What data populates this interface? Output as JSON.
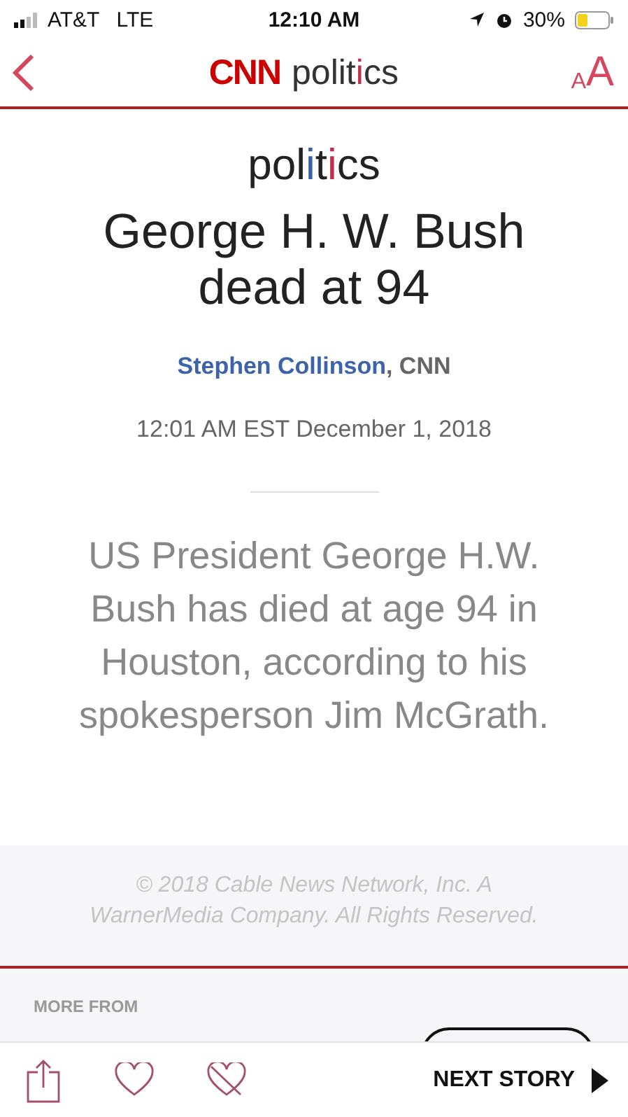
{
  "status_bar": {
    "carrier": "AT&T",
    "network": "LTE",
    "time": "12:10 AM",
    "battery": "30%"
  },
  "nav_bar": {
    "logo": "CNN",
    "section": [
      {
        "text": "polit",
        "color": "#333333"
      },
      {
        "text": "i",
        "color": "#c0304a"
      },
      {
        "text": "cs",
        "color": "#333333"
      }
    ],
    "text_size_small": "A",
    "text_size_large": "A"
  },
  "article": {
    "section_label": [
      {
        "text": "pol",
        "color": "#222222"
      },
      {
        "text": "i",
        "color": "#3b5ea8"
      },
      {
        "text": "t",
        "color": "#222222"
      },
      {
        "text": "i",
        "color": "#c0304a"
      },
      {
        "text": "cs",
        "color": "#222222"
      }
    ],
    "title": "George H. W. Bush dead at 94",
    "author": "Stephen Collinson",
    "source": ", CNN",
    "date": "12:01 AM EST December 1, 2018",
    "summary": "US President George H.W. Bush has died at age 94 in Houston, according to his spokesperson Jim McGrath."
  },
  "footer": {
    "copyright": "© 2018 Cable News Network, Inc. A WarnerMedia Company. All Rights Reserved."
  },
  "more_from": {
    "label": "MORE FROM"
  },
  "toolbar": {
    "next_story": "NEXT STORY"
  }
}
